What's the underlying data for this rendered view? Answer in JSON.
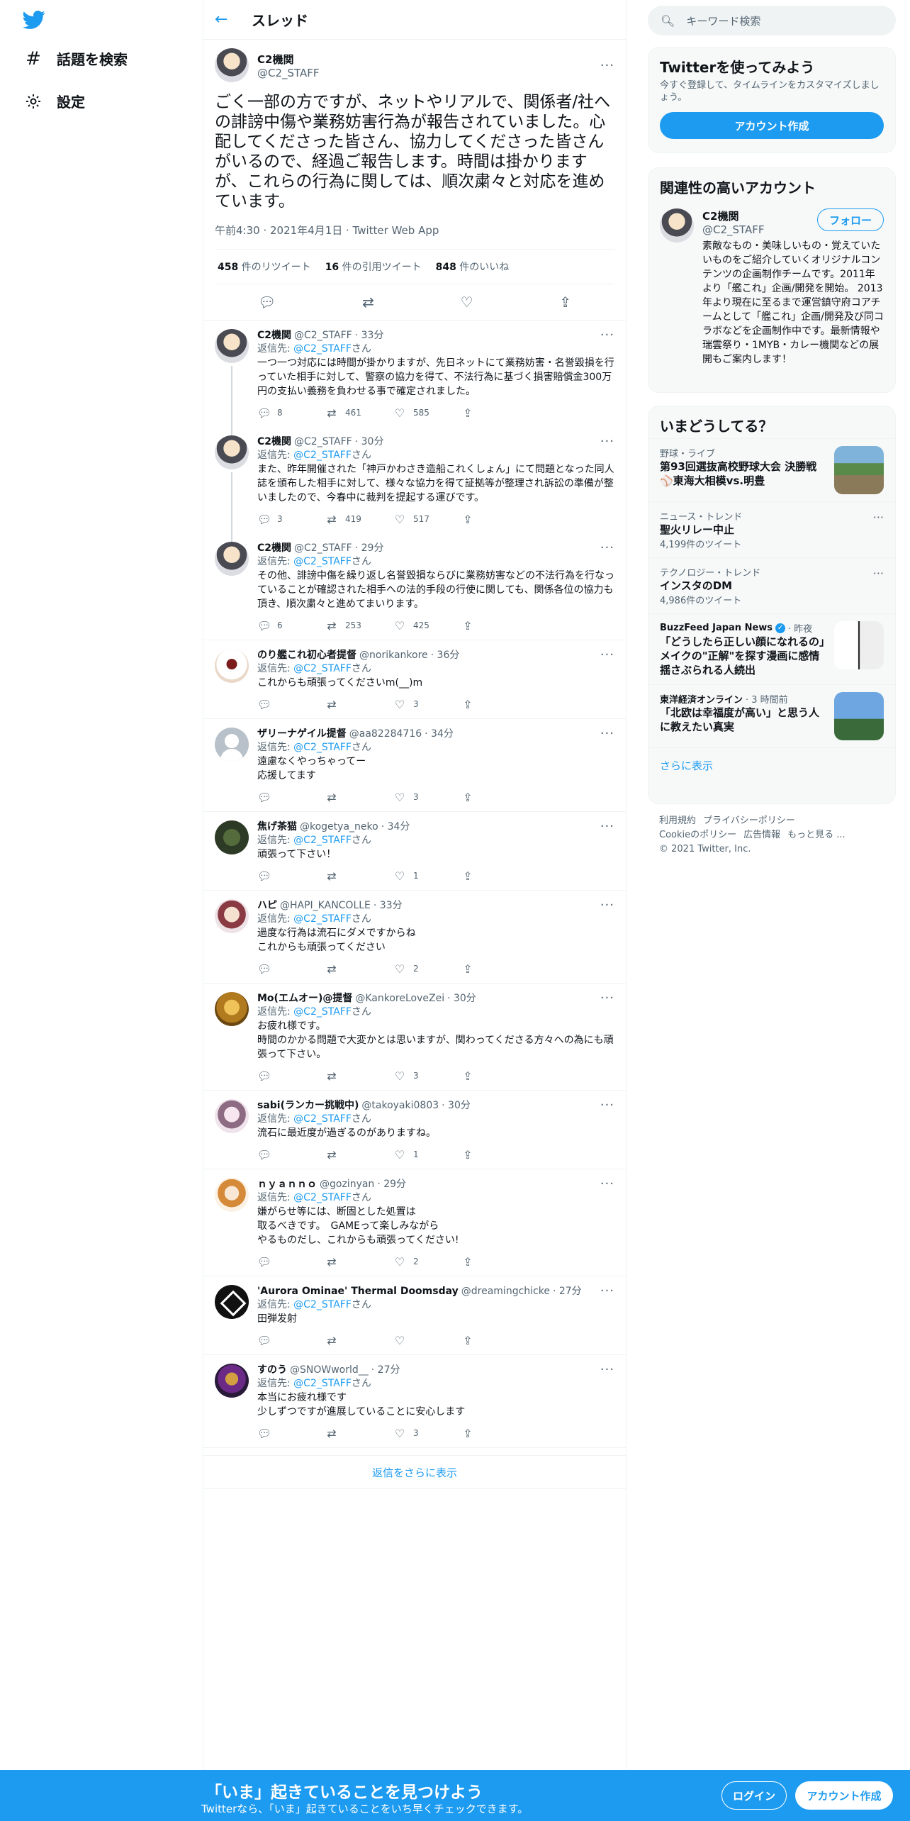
{
  "nav": {
    "explore_label": "話題を検索",
    "settings_label": "設定"
  },
  "header": {
    "title": "スレッド"
  },
  "main_tweet": {
    "name": "C2機関",
    "handle": "@C2_STAFF",
    "text": "ごく一部の方ですが、ネットやリアルで、関係者/社への誹謗中傷や業務妨害行為が報告されていました。心配してくださった皆さん、協力してくださった皆さんがいるので、経過ご報告します。時間は掛かりますが、これらの行為に関しては、順次粛々と対応を進めています。",
    "meta": "午前4:30 · 2021年4月1日 · Twitter Web App",
    "retweets_num": "458",
    "retweets_label": "件のリツイート",
    "quotes_num": "16",
    "quotes_label": "件の引用ツイート",
    "likes_num": "848",
    "likes_label": "件のいいね"
  },
  "replies": [
    {
      "name": "C2機関",
      "handle": "@C2_STAFF",
      "time": "· 33分",
      "reply_prefix": "返信先: ",
      "reply_to": "@C2_STAFF",
      "reply_suffix": "さん",
      "text": "一つ一つ対応には時間が掛かりますが、先日ネットにて業務妨害・名誉毀損を行っていた相手に対して、警察の協力を得て、不法行為に基づく損害賠償金300万円の支払い義務を負わせる事で確定されました。",
      "replies": "8",
      "retweets": "461",
      "likes": "585"
    },
    {
      "name": "C2機関",
      "handle": "@C2_STAFF",
      "time": "· 30分",
      "reply_prefix": "返信先: ",
      "reply_to": "@C2_STAFF",
      "reply_suffix": "さん",
      "text": "また、昨年開催された「神戸かわさき造船これくしょん」にて問題となった同人誌を頒布した相手に対して、様々な協力を得て証拠等が整理され訴訟の準備が整いましたので、今春中に裁判を提起する運びです。",
      "replies": "3",
      "retweets": "419",
      "likes": "517"
    },
    {
      "name": "C2機関",
      "handle": "@C2_STAFF",
      "time": "· 29分",
      "reply_prefix": "返信先: ",
      "reply_to": "@C2_STAFF",
      "reply_suffix": "さん",
      "text": "その他、誹謗中傷を繰り返し名誉毀損ならびに業務妨害などの不法行為を行なっていることが確認された相手への法的手段の行使に関しても、関係各位の協力も頂き、順次粛々と進めてまいります。",
      "replies": "6",
      "retweets": "253",
      "likes": "425"
    },
    {
      "name": "のり艦これ初心者提督",
      "handle": "@norikankore",
      "time": "· 36分",
      "reply_prefix": "返信先: ",
      "reply_to": "@C2_STAFF",
      "reply_suffix": "さん",
      "text": "これからも頑張ってくださいm(__)m",
      "replies": "",
      "retweets": "",
      "likes": "3"
    },
    {
      "name": "ザリーナゲイル提督",
      "handle": "@aa82284716",
      "time": "· 34分",
      "reply_prefix": "返信先: ",
      "reply_to": "@C2_STAFF",
      "reply_suffix": "さん",
      "text": "遠慮なくやっちゃってー\n応援してます",
      "replies": "",
      "retweets": "",
      "likes": "3"
    },
    {
      "name": "焦げ茶猫",
      "handle": "@kogetya_neko",
      "time": "· 34分",
      "reply_prefix": "返信先: ",
      "reply_to": "@C2_STAFF",
      "reply_suffix": "さん",
      "text": "頑張って下さい！",
      "replies": "",
      "retweets": "",
      "likes": "1"
    },
    {
      "name": "ハピ",
      "handle": "@HAPI_KANCOLLE",
      "time": "· 33分",
      "reply_prefix": "返信先: ",
      "reply_to": "@C2_STAFF",
      "reply_suffix": "さん",
      "text": "過度な行為は流石にダメですからね\nこれからも頑張ってください",
      "replies": "",
      "retweets": "",
      "likes": "2"
    },
    {
      "name": "Mo(エムオー)@提督",
      "handle": "@KankoreLoveZei",
      "time": "· 30分",
      "reply_prefix": "返信先: ",
      "reply_to": "@C2_STAFF",
      "reply_suffix": "さん",
      "text": "お疲れ様です。\n時間のかかる問題で大変かとは思いますが、関わってくださる方々への為にも頑張って下さい。",
      "replies": "",
      "retweets": "",
      "likes": "3"
    },
    {
      "name": "sabi(ランカー挑戦中)",
      "handle": "@takoyaki0803",
      "time": "· 30分",
      "reply_prefix": "返信先: ",
      "reply_to": "@C2_STAFF",
      "reply_suffix": "さん",
      "text": "流石に最近度が過ぎるのがありますね。",
      "replies": "",
      "retweets": "",
      "likes": "1"
    },
    {
      "name": "ｎｙａｎｎｏ",
      "handle": "@gozinyan",
      "time": "· 29分",
      "reply_prefix": "返信先: ",
      "reply_to": "@C2_STAFF",
      "reply_suffix": "さん",
      "text": "嫌がらせ等には、断固とした処置は\n取るべきです。　GAMEって楽しみながら\nやるものだし、これからも頑張ってください!",
      "replies": "",
      "retweets": "",
      "likes": "2"
    },
    {
      "name": "'Aurora Ominae' Thermal Doomsday",
      "handle": "@dreamingchicke",
      "time": "· 27分",
      "reply_prefix": "返信先: ",
      "reply_to": "@C2_STAFF",
      "reply_suffix": "さん",
      "text": "田弾发射",
      "replies": "",
      "retweets": "",
      "likes": ""
    },
    {
      "name": "すのう",
      "handle": "@SNOWworld__",
      "time": "· 27分",
      "reply_prefix": "返信先: ",
      "reply_to": "@C2_STAFF",
      "reply_suffix": "さん",
      "text": "本当にお疲れ様です\n少しずつですが進展していることに安心します",
      "replies": "",
      "retweets": "",
      "likes": "3"
    }
  ],
  "show_more_replies": "返信をさらに表示",
  "search": {
    "placeholder": "キーワード検索"
  },
  "signup_card": {
    "title": "Twitterを使ってみよう",
    "subtitle": "今すぐ登録して、タイムラインをカスタマイズしましょう。",
    "button": "アカウント作成"
  },
  "relevant": {
    "title": "関連性の高いアカウント",
    "name": "C2機関",
    "handle": "@C2_STAFF",
    "follow": "フォロー",
    "bio": "素敵なもの・美味しいもの・覚えていたいものをご紹介していくオリジナルコンテンツの企画制作チームです。2011年より「艦これ」企画/開発を開始。 2013年より現在に至るまで運営鎮守府コアチームとして「艦これ」企画/開発及び同コラボなどを企画制作中です。最新情報や瑞雲祭り・1MYB・カレー機関などの展開もご案内します！"
  },
  "trends": {
    "title": "いまどうしてる？",
    "items": [
      {
        "category": "野球・ライブ",
        "title": "第93回選抜高校野球大会 決勝戦 ⚾東海大相模vs.明豊",
        "count": ""
      },
      {
        "category": "ニュース・トレンド",
        "title": "聖火リレー中止",
        "count": "4,199件のツイート"
      },
      {
        "category": "テクノロジー・トレンド",
        "title": "インスタのDM",
        "count": "4,986件のツイート"
      },
      {
        "source": "BuzzFeed Japan News",
        "time": "· 昨夜",
        "title": "「どうしたら正しい顔になれるの」メイクの\"正解\"を探す漫画に感情揺さぶられる人続出"
      },
      {
        "source": "東洋経済オンライン",
        "time": "· 3 時間前",
        "title": "「北欧は幸福度が高い」と思う人に教えたい真実"
      }
    ],
    "show_more": "さらに表示"
  },
  "footer": {
    "l1": "利用規約",
    "l2": "プライバシーポリシー",
    "l3": "Cookieのポリシー",
    "l4": "広告情報",
    "l5": "もっと見る ...",
    "copyright": "© 2021 Twitter, Inc."
  },
  "bottom_bar": {
    "title": "「いま」起きていることを見つけよう",
    "subtitle": "Twitterなら、「いま」起きていることをいち早くチェックできます。",
    "login": "ログイン",
    "signup": "アカウント作成"
  },
  "colors": {
    "accent": "#1d9bf0",
    "text": "#0f1419",
    "secondary": "#536471"
  }
}
